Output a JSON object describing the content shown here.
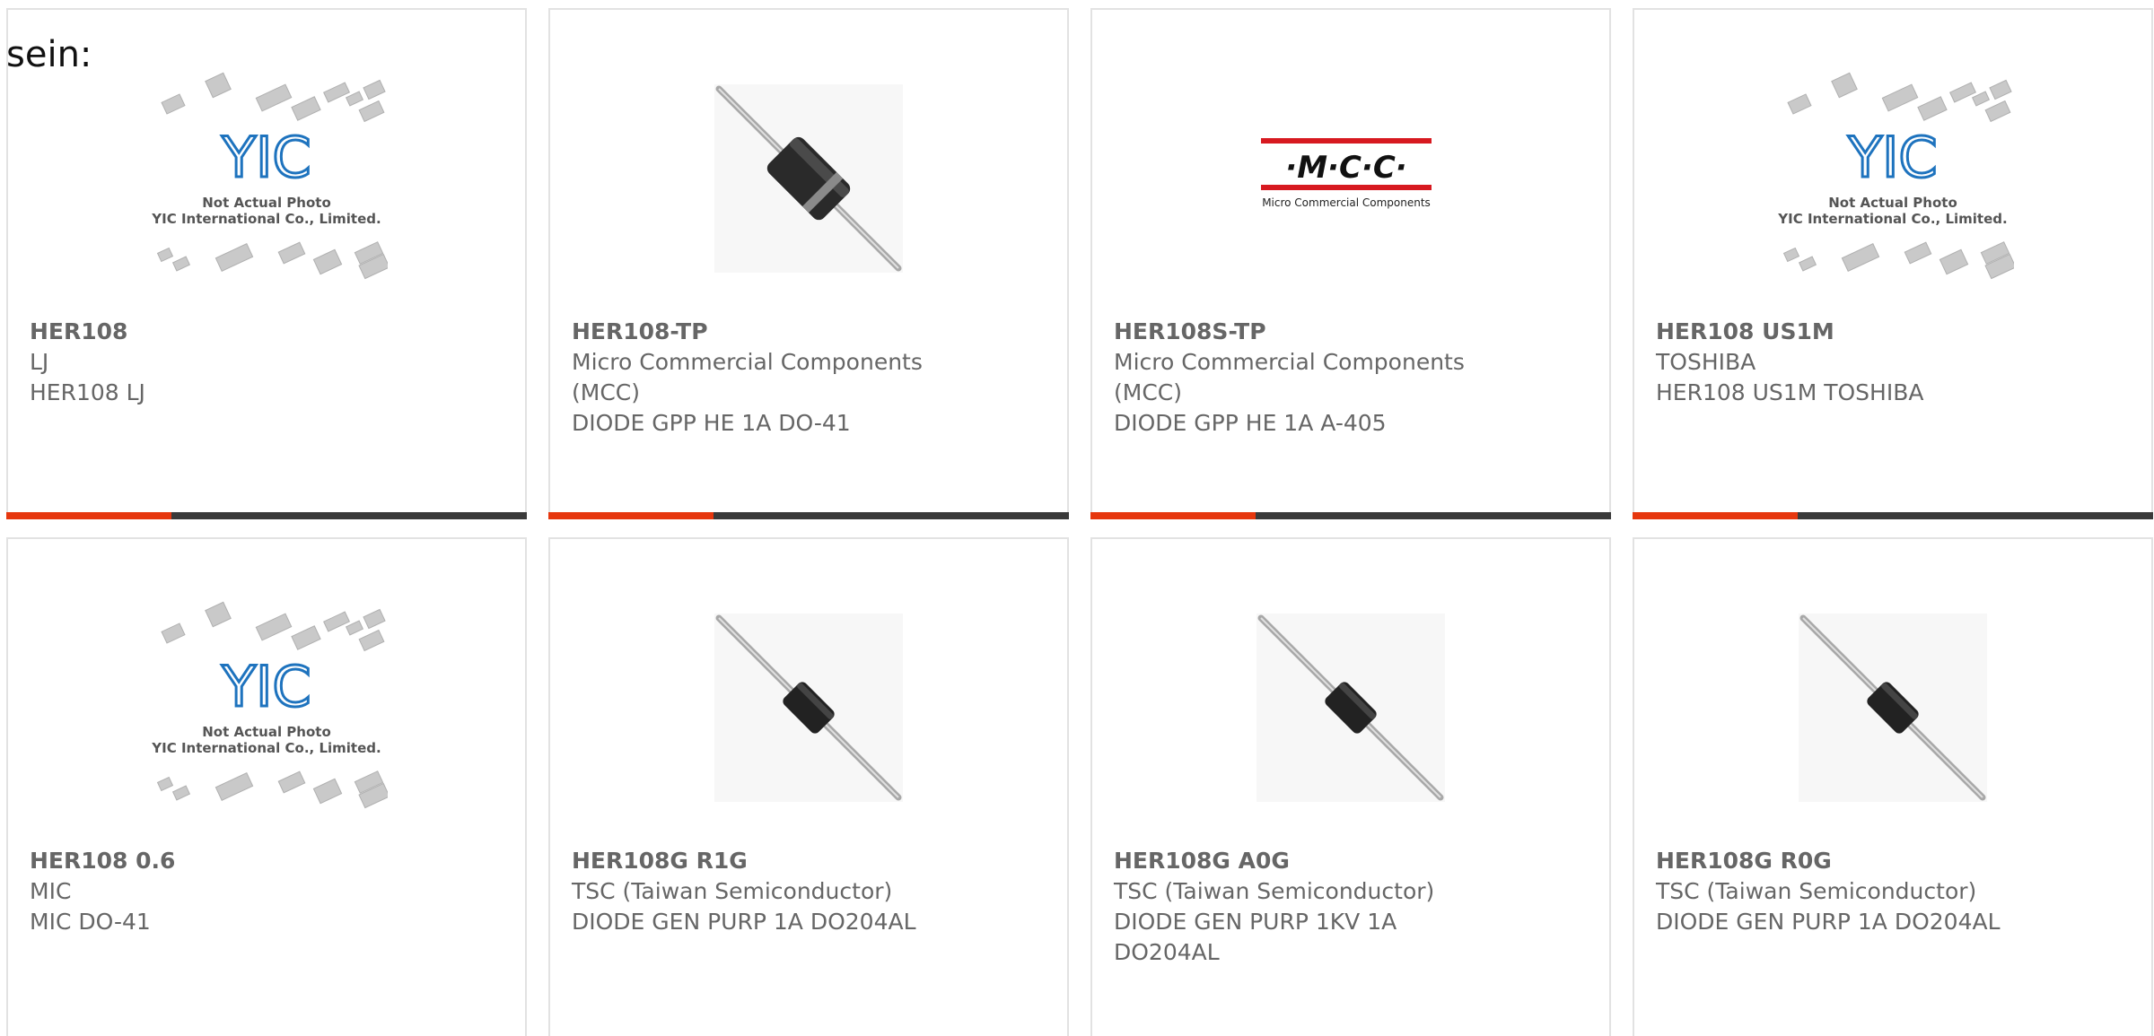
{
  "page": {
    "top_text": "sein:"
  },
  "colors": {
    "accent": "#e6370e",
    "bar": "#3a3a3a",
    "border": "#e2e2e2",
    "yic_blue": "#1e73be",
    "mcc_red": "#d71920"
  },
  "products": [
    {
      "part": "HER108",
      "lines": [
        "LJ",
        "HER108 LJ"
      ],
      "image": "yic-placeholder",
      "image_text": [
        "Not Actual Photo",
        "YIC International Co., Limited."
      ],
      "logo_text": "YIC"
    },
    {
      "part": "HER108-TP",
      "lines": [
        "Micro Commercial Components",
        "(MCC)",
        "DIODE GPP HE 1A DO-41"
      ],
      "image": "diode-large"
    },
    {
      "part": "HER108S-TP",
      "lines": [
        "Micro Commercial Components",
        "(MCC)",
        "DIODE GPP HE 1A A-405"
      ],
      "image": "mcc-logo",
      "image_text": [
        "·M·C·C·",
        "Micro Commercial Components"
      ]
    },
    {
      "part": "HER108 US1M",
      "lines": [
        "TOSHIBA",
        "HER108 US1M TOSHIBA"
      ],
      "image": "yic-placeholder",
      "image_text": [
        "Not Actual Photo",
        "YIC International Co., Limited."
      ],
      "logo_text": "YIC"
    },
    {
      "part": "HER108 0.6",
      "lines": [
        "MIC",
        "MIC DO-41"
      ],
      "image": "yic-placeholder",
      "image_text": [
        "Not Actual Photo",
        "YIC International Co., Limited."
      ],
      "logo_text": "YIC"
    },
    {
      "part": "HER108G R1G",
      "lines": [
        "TSC (Taiwan Semiconductor)",
        "DIODE GEN PURP 1A DO204AL"
      ],
      "image": "diode-small"
    },
    {
      "part": "HER108G A0G",
      "lines": [
        "TSC (Taiwan Semiconductor)",
        "DIODE GEN PURP 1KV 1A",
        "DO204AL"
      ],
      "image": "diode-small"
    },
    {
      "part": "HER108G R0G",
      "lines": [
        "TSC (Taiwan Semiconductor)",
        "DIODE GEN PURP 1A DO204AL"
      ],
      "image": "diode-small"
    }
  ]
}
